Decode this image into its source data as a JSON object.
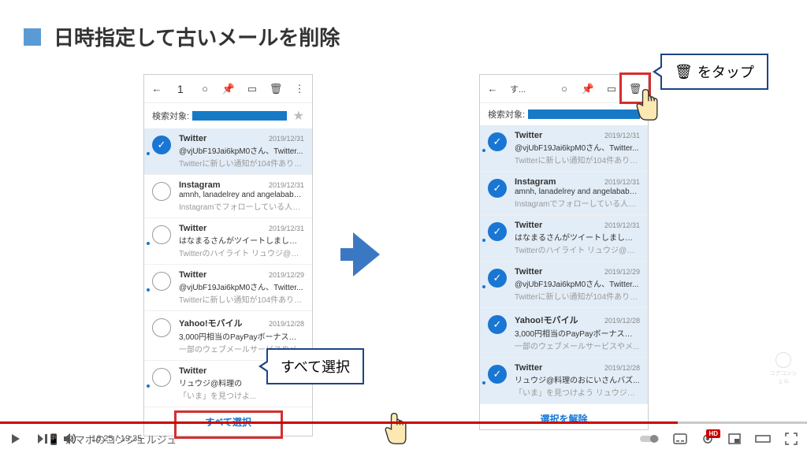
{
  "slide": {
    "title": "日時指定して古いメールを削除"
  },
  "callouts": {
    "select_all": "すべて選択",
    "tap_trash": "をタップ"
  },
  "phone_left": {
    "toolbar_count": "1",
    "search_label": "検索対象:",
    "bottom_button": "すべて選択",
    "emails": [
      {
        "sender": "Twitter",
        "date": "2019/12/31",
        "subject": "@vjUbF19Jai6kpM0さん、Twitter...",
        "preview": "Twitterに新しい通知が104件ありま...",
        "selected": true,
        "dot": true
      },
      {
        "sender": "Instagram",
        "date": "2019/12/31",
        "subject": "amnh, lanadelrey and angelababyct...",
        "preview": "Instagramでフォローしている人の...",
        "selected": false,
        "dot": false
      },
      {
        "sender": "Twitter",
        "date": "2019/12/31",
        "subject": "はなまるさんがツイートしました:...",
        "preview": "Twitterのハイライト リュウジ@料...",
        "selected": false,
        "dot": true
      },
      {
        "sender": "Twitter",
        "date": "2019/12/29",
        "subject": "@vjUbF19Jai6kpM0さん、Twitter...",
        "preview": "Twitterに新しい通知が104件ありま...",
        "selected": false,
        "dot": true
      },
      {
        "sender": "Yahoo!モバイル",
        "date": "2019/12/28",
        "subject": "3,000円相当のPayPayボーナスライ...",
        "preview": "一部のウェブメールサービスやメ...",
        "selected": false,
        "dot": false
      },
      {
        "sender": "Twitter",
        "date": "2019/12/28",
        "subject": "リュウジ@料理の",
        "preview": "「いま」を見つけよ...",
        "selected": false,
        "dot": true
      }
    ]
  },
  "phone_right": {
    "toolbar_text": "す...",
    "search_label": "検索対象:",
    "bottom_button": "選択を解除",
    "emails": [
      {
        "sender": "Twitter",
        "date": "2019/12/31",
        "subject": "@vjUbF19Jai6kpM0さん、Twitter...",
        "preview": "Twitterに新しい通知が104件ありま...",
        "selected": true,
        "dot": true
      },
      {
        "sender": "Instagram",
        "date": "2019/12/31",
        "subject": "amnh, lanadelrey and angelababyct...",
        "preview": "Instagramでフォローしている人の...",
        "selected": true,
        "dot": false
      },
      {
        "sender": "Twitter",
        "date": "2019/12/31",
        "subject": "はなまるさんがツイートしました:...",
        "preview": "Twitterのハイライト リュウジ@料...",
        "selected": true,
        "dot": true
      },
      {
        "sender": "Twitter",
        "date": "2019/12/29",
        "subject": "@vjUbF19Jai6kpM0さん、Twitter...",
        "preview": "Twitterに新しい通知が104件ありま...",
        "selected": true,
        "dot": true
      },
      {
        "sender": "Yahoo!モバイル",
        "date": "2019/12/28",
        "subject": "3,000円相当のPayPayボーナスライ...",
        "preview": "一部のウェブメールサービスやメ...",
        "selected": true,
        "dot": false
      },
      {
        "sender": "Twitter",
        "date": "2019/12/28",
        "subject": "リュウジ@料理のおにいさんバズ...",
        "preview": "「いま」を見つけよう リュウジ@...",
        "selected": true,
        "dot": true
      }
    ]
  },
  "player": {
    "current": "16:25",
    "duration": "19:35",
    "progress_pct": 84,
    "brand": "スマホのコンシェルジュ",
    "quality": "HD"
  },
  "watermark": "コアコンシェル"
}
